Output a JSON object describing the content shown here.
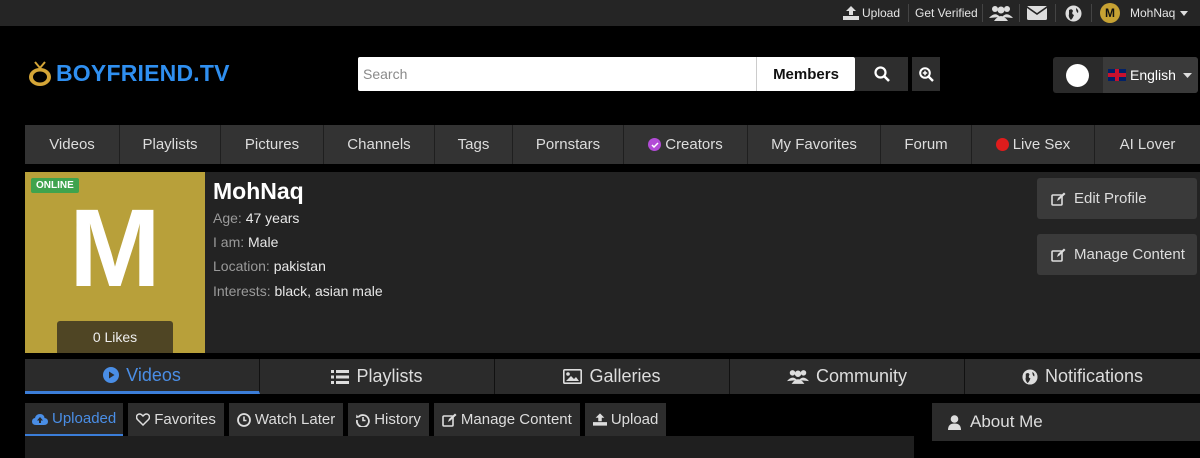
{
  "topbar": {
    "upload_label": "Upload",
    "get_verified_label": "Get Verified",
    "avatar_letter": "M",
    "username": "MohNaq"
  },
  "header": {
    "logo_text": "BOYFRIEND.TV",
    "search_placeholder": "Search",
    "search_type": "Members",
    "language": "English"
  },
  "nav": {
    "items": [
      {
        "label": "Videos"
      },
      {
        "label": "Playlists"
      },
      {
        "label": "Pictures"
      },
      {
        "label": "Channels"
      },
      {
        "label": "Tags"
      },
      {
        "label": "Pornstars"
      },
      {
        "label": "Creators",
        "dot_color": "#b24bd6"
      },
      {
        "label": "My Favorites"
      },
      {
        "label": "Forum"
      },
      {
        "label": "Live Sex",
        "dot_color": "#e01c1c"
      },
      {
        "label": "AI Lover"
      }
    ]
  },
  "profile": {
    "avatar_letter": "M",
    "status_badge": "ONLINE",
    "likes": "0 Likes",
    "name": "MohNaq",
    "age_label": "Age:",
    "age_value": "47 years",
    "iam_label": "I am:",
    "iam_value": "Male",
    "location_label": "Location:",
    "location_value": "pakistan",
    "interests_label": "Interests:",
    "interests_value": "black, asian male",
    "edit_profile_label": "Edit Profile",
    "manage_content_label": "Manage Content"
  },
  "tabs": {
    "videos": "Videos",
    "playlists": "Playlists",
    "galleries": "Galleries",
    "community": "Community",
    "notifications": "Notifications"
  },
  "subtabs": {
    "uploaded": "Uploaded",
    "favorites": "Favorites",
    "watch_later": "Watch Later",
    "history": "History",
    "manage_content": "Manage Content",
    "upload": "Upload"
  },
  "sidebar": {
    "about_me": "About Me"
  },
  "colors": {
    "accent": "#3b7dd8",
    "brand": "#2f8ff0",
    "avatar_bg": "#b8a03a",
    "online": "#3fa34d"
  }
}
